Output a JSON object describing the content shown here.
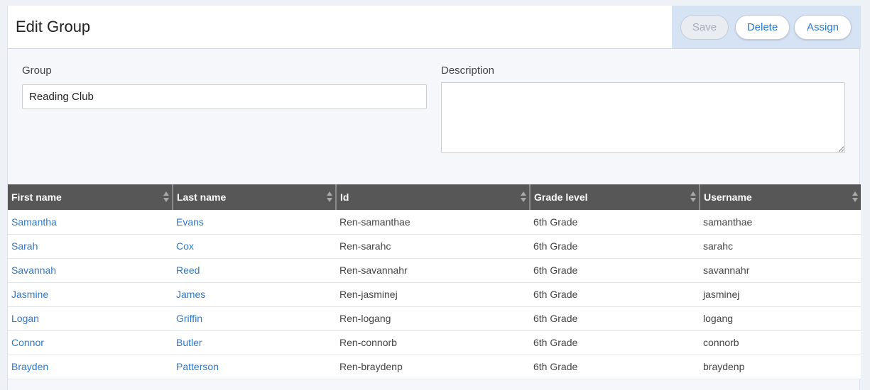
{
  "header": {
    "title": "Edit Group"
  },
  "actions": {
    "save": "Save",
    "delete": "Delete",
    "assign": "Assign"
  },
  "form": {
    "group_label": "Group",
    "group_value": "Reading Club",
    "description_label": "Description",
    "description_value": ""
  },
  "table": {
    "columns": [
      "First name",
      "Last name",
      "Id",
      "Grade level",
      "Username"
    ],
    "rows": [
      [
        "Samantha",
        "Evans",
        "Ren-samanthae",
        "6th Grade",
        "samanthae"
      ],
      [
        "Sarah",
        "Cox",
        "Ren-sarahc",
        "6th Grade",
        "sarahc"
      ],
      [
        "Savannah",
        "Reed",
        "Ren-savannahr",
        "6th Grade",
        "savannahr"
      ],
      [
        "Jasmine",
        "James",
        "Ren-jasminej",
        "6th Grade",
        "jasminej"
      ],
      [
        "Logan",
        "Griffin",
        "Ren-logang",
        "6th Grade",
        "logang"
      ],
      [
        "Connor",
        "Butler",
        "Ren-connorb",
        "6th Grade",
        "connorb"
      ],
      [
        "Brayden",
        "Patterson",
        "Ren-braydenp",
        "6th Grade",
        "braydenp"
      ]
    ]
  }
}
